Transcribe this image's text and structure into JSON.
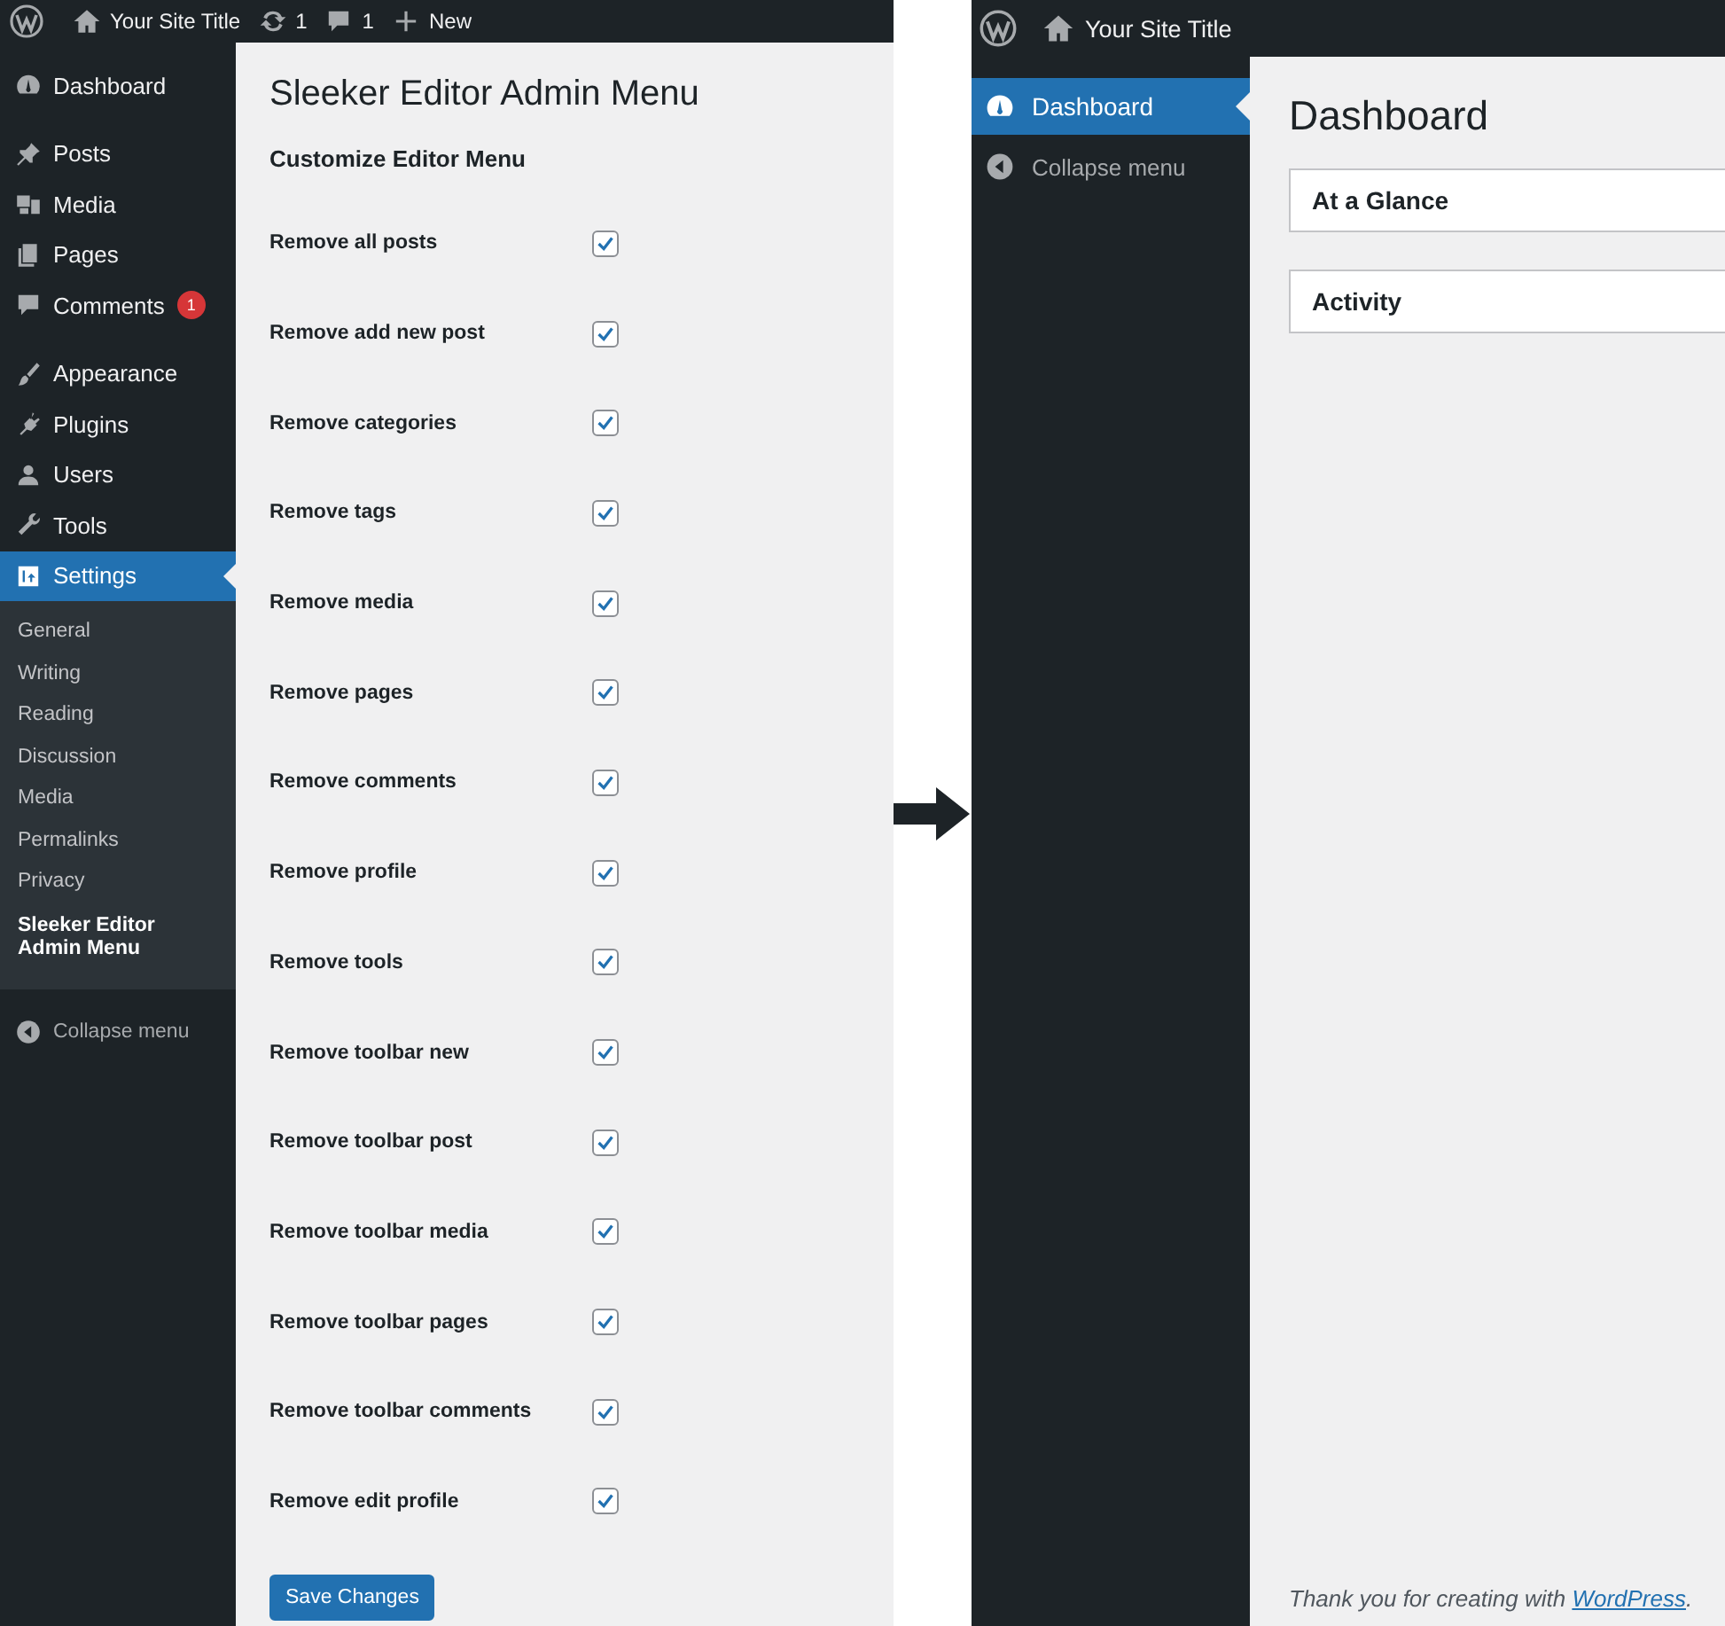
{
  "left_screen": {
    "admin_bar": {
      "site_title": "Your Site Title",
      "updates": "1",
      "comments": "1",
      "new_label": "New"
    },
    "sidebar": {
      "groups": [
        {
          "items": [
            {
              "label": "Dashboard",
              "selected": false
            }
          ]
        },
        {
          "items": [
            {
              "label": "Posts",
              "selected": false
            },
            {
              "label": "Media",
              "selected": false
            },
            {
              "label": "Pages",
              "selected": false
            },
            {
              "label": "Comments",
              "selected": false,
              "badge": "1"
            }
          ]
        },
        {
          "items": [
            {
              "label": "Appearance",
              "selected": false
            },
            {
              "label": "Plugins",
              "selected": false
            },
            {
              "label": "Users",
              "selected": false
            },
            {
              "label": "Tools",
              "selected": false
            },
            {
              "label": "Settings",
              "selected": true,
              "children": [
                {
                  "label": "General",
                  "selected": false
                },
                {
                  "label": "Writing",
                  "selected": false
                },
                {
                  "label": "Reading",
                  "selected": false
                },
                {
                  "label": "Discussion",
                  "selected": false
                },
                {
                  "label": "Media",
                  "selected": false
                },
                {
                  "label": "Permalinks",
                  "selected": false
                },
                {
                  "label": "Privacy",
                  "selected": false
                },
                {
                  "label": "Sleeker Editor Admin Menu",
                  "selected": true
                }
              ]
            }
          ]
        }
      ],
      "collapse": "Collapse menu"
    },
    "page": {
      "title": "Sleeker Editor Admin Menu",
      "section_title": "Customize Editor Menu",
      "options": [
        {
          "label": "Remove all posts",
          "checked": true
        },
        {
          "label": "Remove add new post",
          "checked": true
        },
        {
          "label": "Remove categories",
          "checked": true
        },
        {
          "label": "Remove tags",
          "checked": true
        },
        {
          "label": "Remove media",
          "checked": true
        },
        {
          "label": "Remove pages",
          "checked": true
        },
        {
          "label": "Remove comments",
          "checked": true
        },
        {
          "label": "Remove profile",
          "checked": true
        },
        {
          "label": "Remove tools",
          "checked": true
        },
        {
          "label": "Remove toolbar new",
          "checked": true
        },
        {
          "label": "Remove toolbar post",
          "checked": true
        },
        {
          "label": "Remove toolbar media",
          "checked": true
        },
        {
          "label": "Remove toolbar pages",
          "checked": true
        },
        {
          "label": "Remove toolbar comments",
          "checked": true
        },
        {
          "label": "Remove edit profile",
          "checked": true
        }
      ],
      "save_button": "Save Changes"
    }
  },
  "right_screen": {
    "admin_bar": {
      "site_title": "Your Site Title"
    },
    "sidebar": {
      "items": [
        {
          "label": "Dashboard",
          "selected": true
        }
      ],
      "collapse": "Collapse menu"
    },
    "page": {
      "title": "Dashboard",
      "panels": [
        {
          "title": "At a Glance"
        },
        {
          "title": "Activity"
        }
      ],
      "footer": {
        "text": "Thank you for creating with ",
        "link": "WordPress",
        "after": "."
      }
    }
  }
}
